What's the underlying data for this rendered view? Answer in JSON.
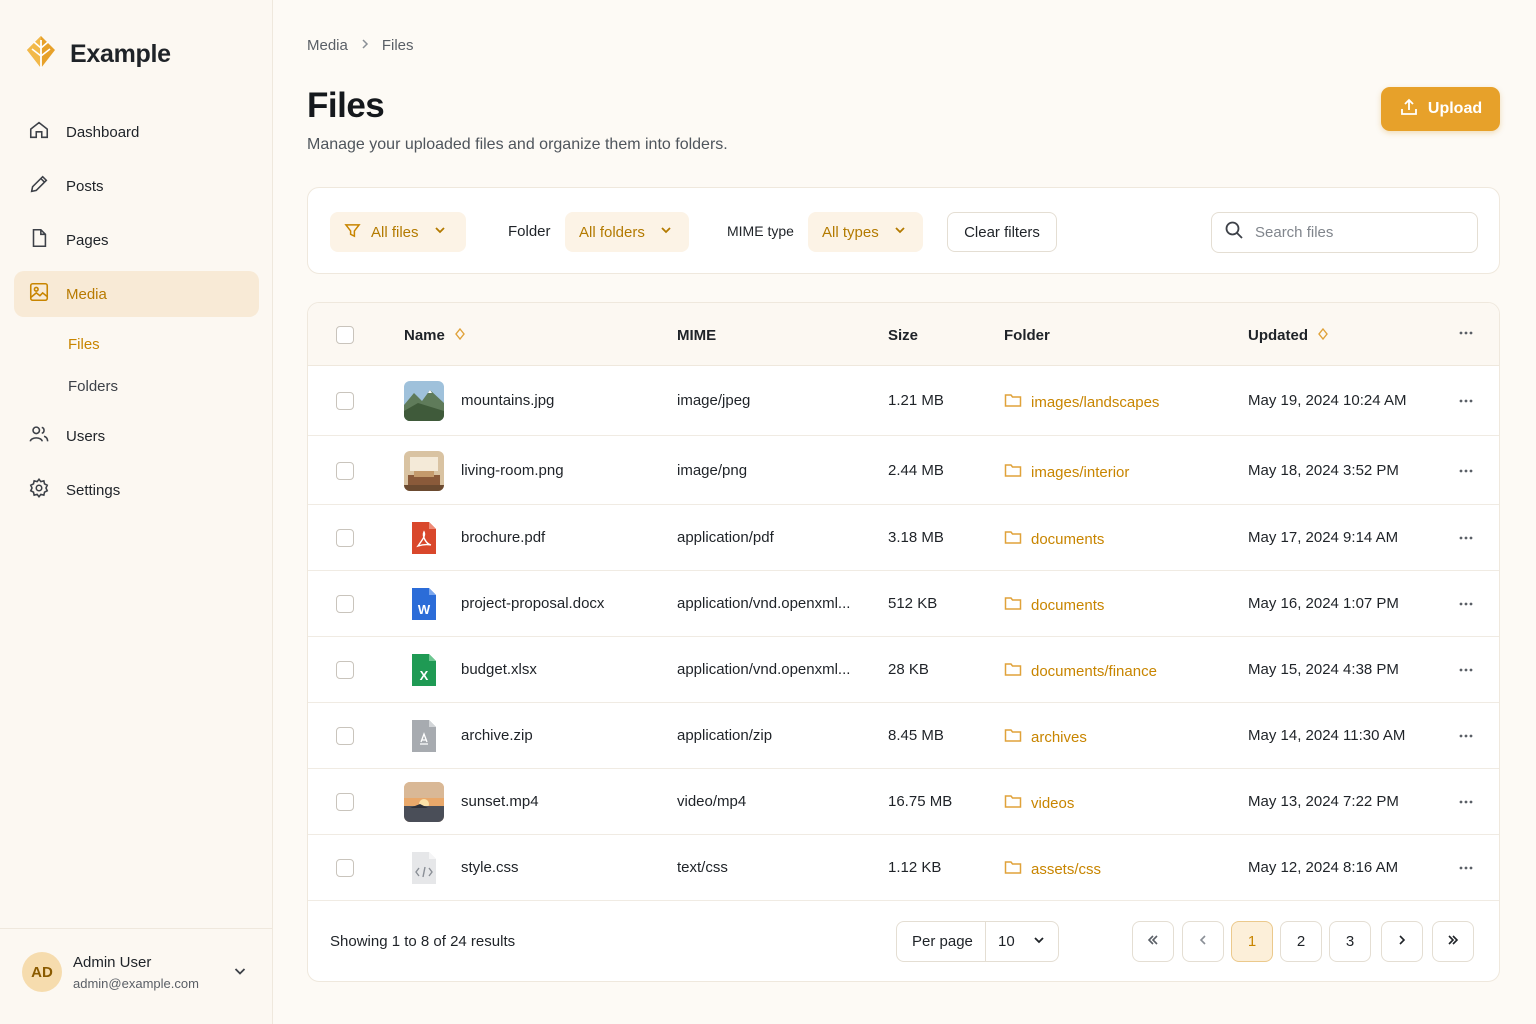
{
  "brand": {
    "name": "Example"
  },
  "sidebar": {
    "items": [
      {
        "label": "Dashboard",
        "icon": "home-icon"
      },
      {
        "label": "Posts",
        "icon": "pencil-icon"
      },
      {
        "label": "Pages",
        "icon": "page-icon"
      },
      {
        "label": "Media",
        "icon": "image-icon"
      },
      {
        "label": "Users",
        "icon": "users-icon"
      },
      {
        "label": "Settings",
        "icon": "gear-icon"
      }
    ],
    "sub_items": [
      {
        "label": "Files"
      },
      {
        "label": "Folders"
      }
    ]
  },
  "user": {
    "initials": "AD",
    "name": "Admin User",
    "email": "admin@example.com"
  },
  "breadcrumb": {
    "parent": "Media",
    "current": "Files"
  },
  "page": {
    "title": "Files",
    "subtitle": "Manage your uploaded files and organize them into folders.",
    "upload_label": "Upload"
  },
  "filters": {
    "view": "All files",
    "folder_label": "Folder",
    "folder_value": "All folders",
    "mime_label": "MIME type",
    "mime_value": "All types",
    "clear_label": "Clear filters",
    "search_placeholder": "Search files"
  },
  "table": {
    "columns": {
      "name": "Name",
      "mime": "MIME",
      "size": "Size",
      "folder": "Folder",
      "updated": "Updated"
    },
    "rows": [
      {
        "name": "mountains.jpg",
        "mime": "image/jpeg",
        "size": "1.21 MB",
        "folder": "images/landscapes",
        "updated": "May 19, 2024 10:24 AM",
        "thumb": "mountains"
      },
      {
        "name": "living-room.png",
        "mime": "image/png",
        "size": "2.44 MB",
        "folder": "images/interior",
        "updated": "May 18, 2024 3:52 PM",
        "thumb": "room"
      },
      {
        "name": "brochure.pdf",
        "mime": "application/pdf",
        "size": "3.18 MB",
        "folder": "documents",
        "updated": "May 17, 2024 9:14 AM",
        "thumb": "pdf"
      },
      {
        "name": "project-proposal.docx",
        "mime": "application/vnd.openxml...",
        "size": "512 KB",
        "folder": "documents",
        "updated": "May 16, 2024 1:07 PM",
        "thumb": "word"
      },
      {
        "name": "budget.xlsx",
        "mime": "application/vnd.openxml...",
        "size": "28 KB",
        "folder": "documents/finance",
        "updated": "May 15, 2024 4:38 PM",
        "thumb": "excel"
      },
      {
        "name": "archive.zip",
        "mime": "application/zip",
        "size": "8.45 MB",
        "folder": "archives",
        "updated": "May 14, 2024 11:30 AM",
        "thumb": "zip"
      },
      {
        "name": "sunset.mp4",
        "mime": "video/mp4",
        "size": "16.75 MB",
        "folder": "videos",
        "updated": "May 13, 2024 7:22 PM",
        "thumb": "sunset"
      },
      {
        "name": "style.css",
        "mime": "text/css",
        "size": "1.12 KB",
        "folder": "assets/css",
        "updated": "May 12, 2024 8:16 AM",
        "thumb": "code"
      }
    ]
  },
  "footer": {
    "summary": "Showing 1 to 8 of 24 results",
    "per_page_label": "Per page",
    "per_page_value": "10",
    "pages": [
      "1",
      "2",
      "3"
    ],
    "current_page": "1"
  },
  "colors": {
    "accent": "#e7a12a",
    "accent_text": "#c88500",
    "background": "#fdfaf5"
  }
}
